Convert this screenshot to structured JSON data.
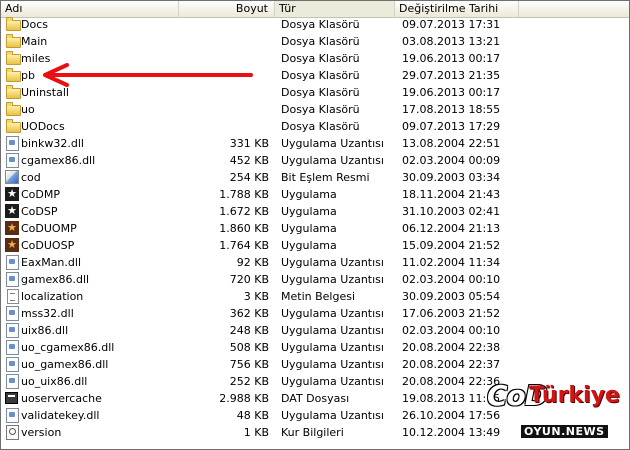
{
  "columns": {
    "name": "Adı",
    "size": "Boyut",
    "type": "Tür",
    "date": "Değiştirilme Tarihi"
  },
  "rows": [
    {
      "icon": "folder",
      "name": "Docs",
      "size": "",
      "type": "Dosya Klasörü",
      "date": "09.07.2013 17:31"
    },
    {
      "icon": "folder",
      "name": "Main",
      "size": "",
      "type": "Dosya Klasörü",
      "date": "03.08.2013 13:21"
    },
    {
      "icon": "folder",
      "name": "miles",
      "size": "",
      "type": "Dosya Klasörü",
      "date": "19.06.2013 00:17"
    },
    {
      "icon": "folder",
      "name": "pb",
      "size": "",
      "type": "Dosya Klasörü",
      "date": "29.07.2013 21:35"
    },
    {
      "icon": "folder",
      "name": "Uninstall",
      "size": "",
      "type": "Dosya Klasörü",
      "date": "19.06.2013 00:17"
    },
    {
      "icon": "folder",
      "name": "uo",
      "size": "",
      "type": "Dosya Klasörü",
      "date": "17.08.2013 18:55"
    },
    {
      "icon": "folder",
      "name": "UODocs",
      "size": "",
      "type": "Dosya Klasörü",
      "date": "09.07.2013 17:29"
    },
    {
      "icon": "dll",
      "name": "binkw32.dll",
      "size": "331 KB",
      "type": "Uygulama Uzantısı",
      "date": "13.08.2004 22:51"
    },
    {
      "icon": "dll",
      "name": "cgamex86.dll",
      "size": "452 KB",
      "type": "Uygulama Uzantısı",
      "date": "02.03.2004 00:09"
    },
    {
      "icon": "bmp",
      "name": "cod",
      "size": "254 KB",
      "type": "Bit Eşlem Resmi",
      "date": "30.09.2003 03:34"
    },
    {
      "icon": "exe",
      "name": "CoDMP",
      "size": "1.788 KB",
      "type": "Uygulama",
      "date": "18.11.2004 21:43"
    },
    {
      "icon": "exe",
      "name": "CoDSP",
      "size": "1.672 KB",
      "type": "Uygulama",
      "date": "31.10.2003 02:41"
    },
    {
      "icon": "exe-uo",
      "name": "CoDUOMP",
      "size": "1.860 KB",
      "type": "Uygulama",
      "date": "06.12.2004 21:13"
    },
    {
      "icon": "exe-uo",
      "name": "CoDUOSP",
      "size": "1.764 KB",
      "type": "Uygulama",
      "date": "15.09.2004 21:52"
    },
    {
      "icon": "dll",
      "name": "EaxMan.dll",
      "size": "92 KB",
      "type": "Uygulama Uzantısı",
      "date": "11.02.2004 11:34"
    },
    {
      "icon": "dll",
      "name": "gamex86.dll",
      "size": "720 KB",
      "type": "Uygulama Uzantısı",
      "date": "02.03.2004 00:10"
    },
    {
      "icon": "txt",
      "name": "localization",
      "size": "3 KB",
      "type": "Metin Belgesi",
      "date": "30.09.2003 05:54"
    },
    {
      "icon": "dll",
      "name": "mss32.dll",
      "size": "362 KB",
      "type": "Uygulama Uzantısı",
      "date": "17.06.2003 21:52"
    },
    {
      "icon": "dll",
      "name": "uix86.dll",
      "size": "248 KB",
      "type": "Uygulama Uzantısı",
      "date": "02.03.2004 00:10"
    },
    {
      "icon": "dll",
      "name": "uo_cgamex86.dll",
      "size": "508 KB",
      "type": "Uygulama Uzantısı",
      "date": "20.08.2004 22:38"
    },
    {
      "icon": "dll",
      "name": "uo_gamex86.dll",
      "size": "756 KB",
      "type": "Uygulama Uzantısı",
      "date": "20.08.2004 22:37"
    },
    {
      "icon": "dll",
      "name": "uo_uix86.dll",
      "size": "252 KB",
      "type": "Uygulama Uzantısı",
      "date": "20.08.2004 22:36"
    },
    {
      "icon": "dat",
      "name": "uoservercache",
      "size": "2.988 KB",
      "type": "DAT Dosyası",
      "date": "19.08.2013 11:15"
    },
    {
      "icon": "dll",
      "name": "validatekey.dll",
      "size": "48 KB",
      "type": "Uygulama Uzantısı",
      "date": "26.10.2004 17:56"
    },
    {
      "icon": "cfg",
      "name": "version",
      "size": "1 KB",
      "type": "Kur Bilgileri",
      "date": "10.12.2004 13:49"
    }
  ],
  "annotation": {
    "arrow_color": "#e81010"
  },
  "watermark": {
    "cod": "CoD",
    "brand": "Türkiye",
    "tagline": "OYUN.NEWS"
  }
}
